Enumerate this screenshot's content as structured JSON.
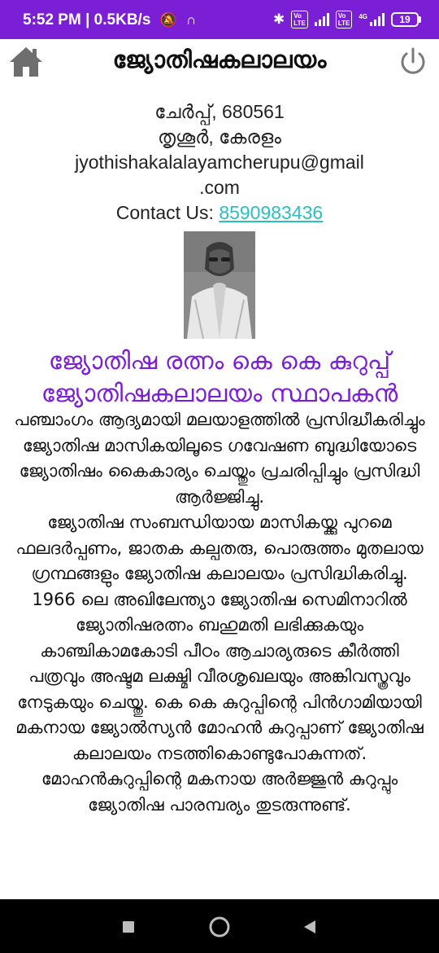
{
  "status_bar": {
    "left_text": "5:52 PM | 0.5KB/s",
    "network_label": "4G",
    "battery": "19",
    "background": "#7a1fd6"
  },
  "app_bar": {
    "title": "ജ്യോതിഷകലാലയം",
    "home_icon": "home-icon",
    "power_icon": "power-icon"
  },
  "contact": {
    "line1": "ചേർപ്പ്, 680561",
    "line2": "തൃശൂർ, കേരളം",
    "email_line1": "jyothishakalalayamcherupu@gmail",
    "email_line2": ".com",
    "contact_label": "Contact Us: ",
    "phone": "8590983436"
  },
  "founder": {
    "line1": "ജ്യോതിഷ രത്നം കെ കെ കുറുപ്പ്",
    "line2": "ജ്യോതിഷകലാലയം സ്ഥാപകൻ",
    "color": "#7b1fd6"
  },
  "article": {
    "paragraph1": "പഞ്ചാംഗം ആദ്യമായി മലയാളത്തിൽ പ്രസിദ്ധീകരിച്ചും ജ്യോതിഷ മാസികയിലൂടെ ഗവേഷണ ബുദ്ധിയോടെ ജ്യോതിഷം കൈകാര്യം ചെയ്തും പ്രചരിപ്പിച്ചും പ്രസിദ്ധി ആർജ്ജിച്ചു.",
    "paragraph2": "ജ്യോതിഷ സംബന്ധിയായ മാസികയ്ക്കു പുറമെ ഫലദർപ്പണം, ജാതക കല്പതരു, പൊരുത്തം മുതലായ ഗ്രന്ഥങ്ങളും ജ്യോതിഷ കലാലയം പ്രസിദ്ധികരിച്ചു. 1966 ലെ അഖിലേന്ത്യാ ജ്യോതിഷ സെമിനാറിൽ ജ്യോതിഷരത്നം ബഹുമതി ലഭിക്കുകയും കാഞ്ചികാമകോടി പീഠം ആചാര്യരുടെ കീർത്തി പത്രവും അഷ്ടമ ലക്ഷ്മി വീരശൃഖലയും അങ്കിവസ്ത്രവും നേടുകയും ചെയ്തു. കെ കെ കുറുപ്പിന്റെ പിൻഗാമിയായി മകനായ ജ്യോൽസ്യൻ മോഹൻ കുറുപ്പാണ് ജ്യോതിഷ കലാലയം നടത്തികൊണ്ടുപോകുന്നത്. മോഹൻകുറുപ്പിന്റെ മകനായ അർജ്ജുൻ കുറുപ്പും ജ്യോതിഷ പാരമ്പര്യം തുടരുന്നുണ്ട്."
  },
  "nav": {
    "recent_icon": "square-icon",
    "home_icon": "circle-home-icon",
    "back_icon": "back-triangle-icon"
  }
}
